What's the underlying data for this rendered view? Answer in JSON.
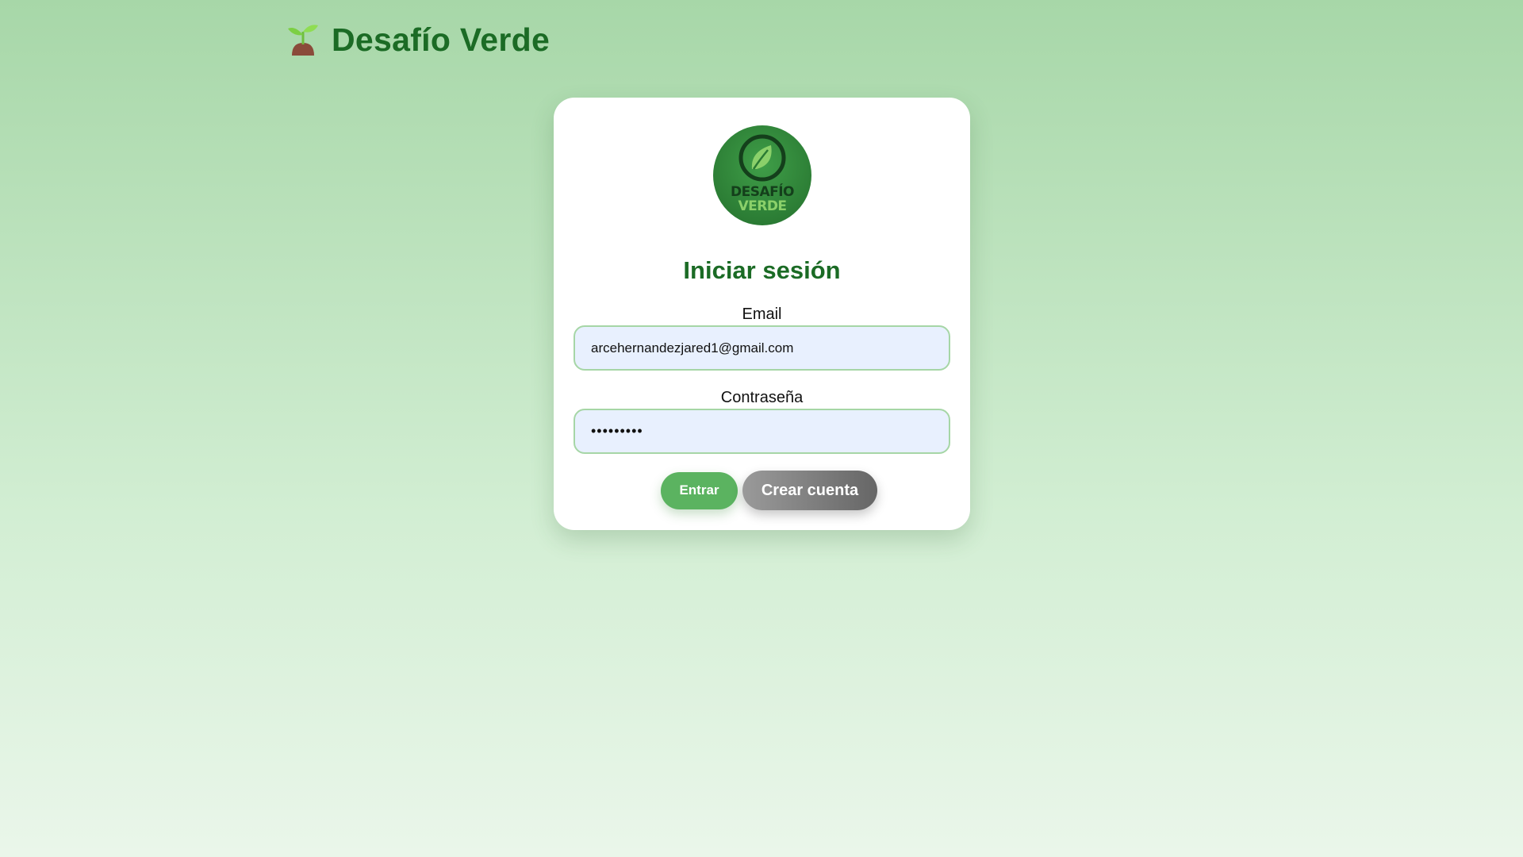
{
  "header": {
    "logo_icon": "sprout-icon",
    "title": "Desafío Verde"
  },
  "card": {
    "logo_icon": "leaf-badge-icon",
    "logo_text_line1": "DESAFÍO",
    "logo_text_line2": "VERDE",
    "title": "Iniciar sesión",
    "email": {
      "label": "Email",
      "value": "arcehernandezjared1@gmail.com"
    },
    "password": {
      "label": "Contraseña",
      "value": "•••••••••"
    },
    "buttons": {
      "enter_label": "Entrar",
      "create_label": "Crear cuenta"
    }
  },
  "colors": {
    "brand_green": "#1b6b25",
    "button_green": "#5bb360",
    "input_bg": "#e8f0fe",
    "input_border": "#a6d6a6",
    "button_gray": "#808080"
  }
}
